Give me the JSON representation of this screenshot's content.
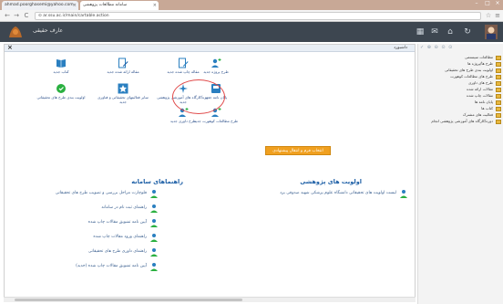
{
  "browser": {
    "tabs": [
      {
        "label": "ahmad.poorghasemi@yahoo.com"
      },
      {
        "label": "سامانه مطالعات پژوهشی"
      }
    ],
    "url": "⊙ ar.ssu.ac.ir/main/cartable.action"
  },
  "app": {
    "title": "عارف حقیقی",
    "icons": [
      "user-icon",
      "refresh-icon",
      "home-icon",
      "mail-icon",
      "grid-icon"
    ]
  },
  "cartable": {
    "title": "داشبورد",
    "close_label": "×",
    "actions": [
      {
        "label": "طرح پروژه جدید",
        "icon": "person-plus-icon"
      },
      {
        "label": "مقاله چاپ شده جدید",
        "icon": "document-edit-icon"
      },
      {
        "label": "مقاله ارائه شده جدید",
        "icon": "document-pen-icon"
      },
      {
        "label": "کتاب جدید",
        "icon": "book-icon"
      },
      {
        "label": "پایان نامه جدید",
        "icon": "thesis-icon"
      },
      {
        "label": "دوره/کارگاه های آموزشی پژوهشی جدید",
        "icon": "workshop-icon"
      },
      {
        "label": "سایر فعالیتهای تحقیقاتی و فناوری جدید",
        "icon": "star-icon"
      },
      {
        "label": "اولویت بندی طرح های تحقیقاتی",
        "icon": "priority-icon"
      },
      {
        "label": "طرح مطالعات کوهورت جدید",
        "icon": "person-plus-icon"
      },
      {
        "label": "طرح داوری جدید",
        "icon": "person-plus-icon"
      }
    ],
    "orange_button": "انتخاب فرم و انتقال پیشنهادی",
    "priorities_title": "اولویت های پژوهشی",
    "priorities_items": [
      "لیست اولویت های تحقیقاتی دانشگاه علوم پزشکی شهید صدوقی یزد"
    ],
    "guides_title": "راهنماهای سامانه",
    "guides_items": [
      "فلوچارت مراحل بررسی و تصویب طرح های تحقیقاتی",
      "راهنمای ثبت نام در سامانه",
      "آیین نامه تشویق مقالات چاپ شده",
      "راهنمای ورود مقالات چاپ شده",
      "راهنمای داوری طرح های تحقیقاتی",
      "آیین نامه تشویق مقالات چاپ شده (جدید)"
    ]
  },
  "side_tree": {
    "toolbar": "✓ ⊕ ⊖ ⊙ ⊙",
    "items": [
      "مطالعات سیستمی",
      "طرح ها/پروژه ها",
      "اولویت بندی طرح های تحقیقاتی",
      "طرح های مطالعات کوهورت",
      "طرح های داوری",
      "مقالات ارائه شده",
      "مقالات چاپ شده",
      "پایان نامه ها",
      "کتاب ها",
      "فعالیت های مشترک",
      "دوره/کارگاه های آموزشی پژوهشی انجام"
    ]
  },
  "colors": {
    "app_bar": "#3d4650",
    "link": "#1d5fa6",
    "orange": "#f0a020",
    "highlight_circle": "#e04a4a"
  }
}
